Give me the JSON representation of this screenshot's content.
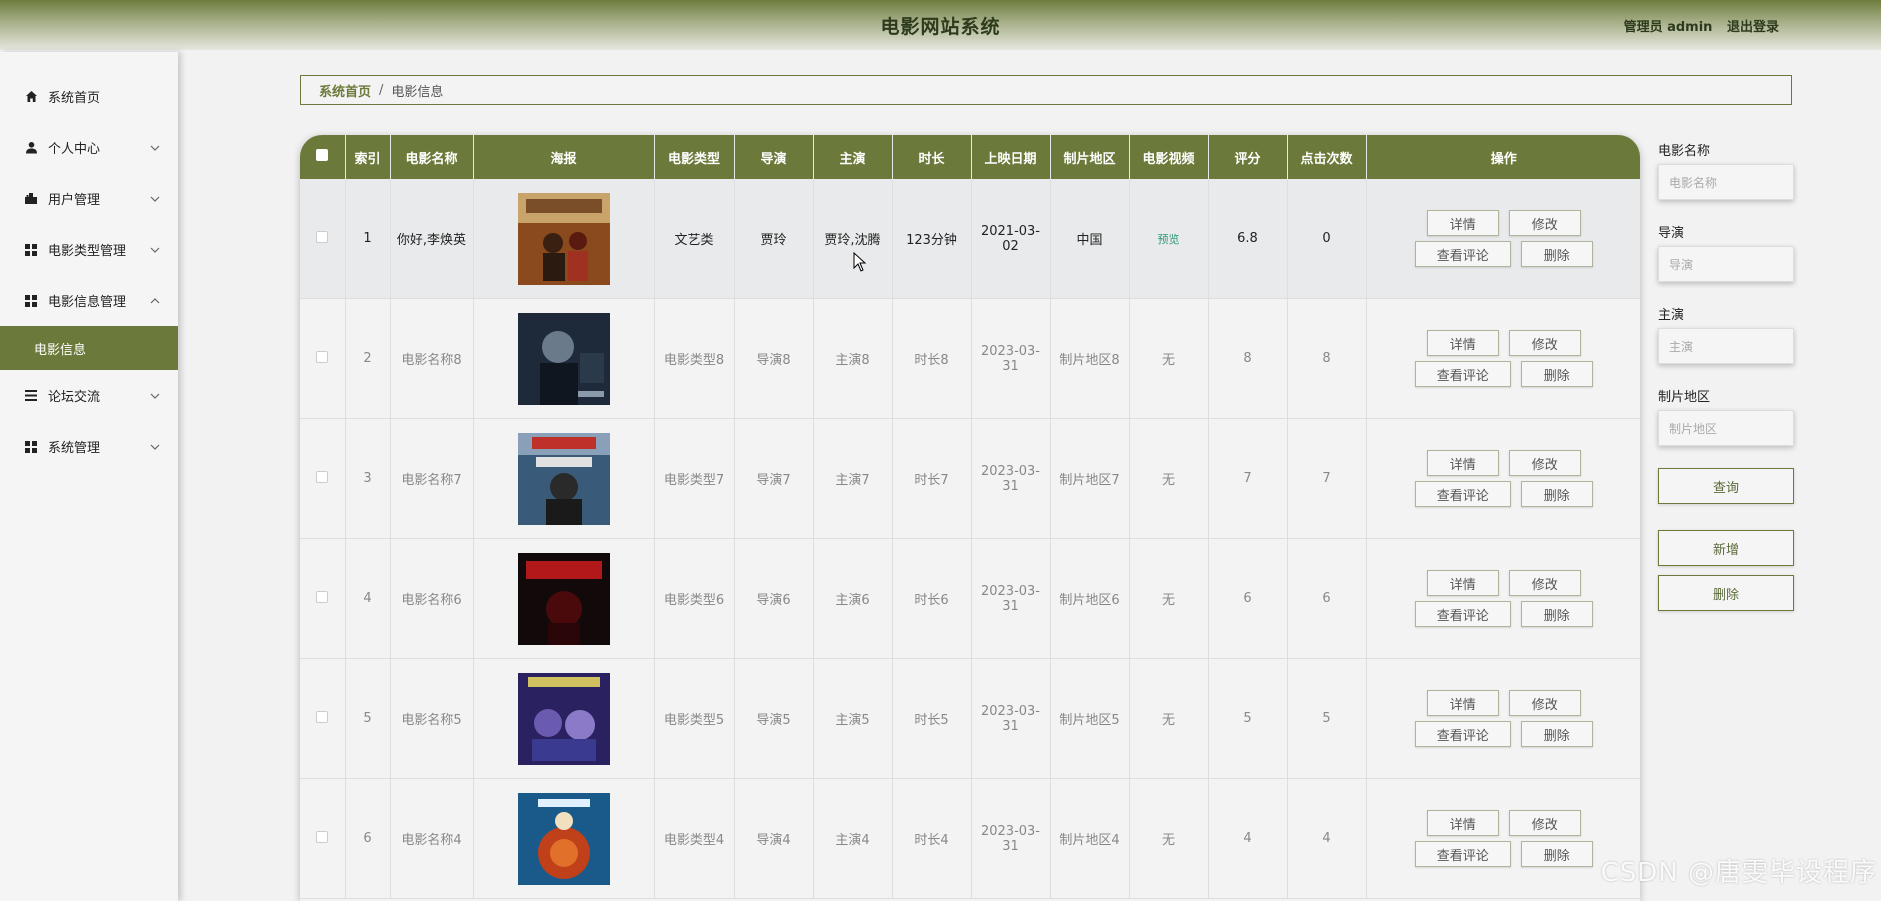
{
  "header": {
    "title": "电影网站系统",
    "user_label": "管理员 admin",
    "logout_label": "退出登录"
  },
  "sidebar": {
    "items": [
      {
        "label": "系统首页",
        "icon": "home-icon",
        "expandable": false
      },
      {
        "label": "个人中心",
        "icon": "user-icon",
        "expandable": true
      },
      {
        "label": "用户管理",
        "icon": "users-icon",
        "expandable": true
      },
      {
        "label": "电影类型管理",
        "icon": "grid-icon",
        "expandable": true
      },
      {
        "label": "电影信息管理",
        "icon": "grid-icon",
        "expandable": true,
        "expanded": true
      },
      {
        "label": "论坛交流",
        "icon": "list-icon",
        "expandable": true
      },
      {
        "label": "系统管理",
        "icon": "grid-icon",
        "expandable": true
      }
    ],
    "active_sub": "电影信息"
  },
  "breadcrumb": {
    "home": "系统首页",
    "separator": "/",
    "current": "电影信息"
  },
  "table": {
    "columns": [
      "索引",
      "电影名称",
      "海报",
      "电影类型",
      "导演",
      "主演",
      "时长",
      "上映日期",
      "制片地区",
      "电影视频",
      "评分",
      "点击次数",
      "操作"
    ],
    "rows": [
      {
        "index": "1",
        "name": "你好,李焕英",
        "type": "文艺类",
        "director": "贾玲",
        "actors": "贾玲,沈腾",
        "duration": "123分钟",
        "date": "2021-03-02",
        "region": "中国",
        "video": "预览",
        "rating": "6.8",
        "clicks": "0"
      },
      {
        "index": "2",
        "name": "电影名称8",
        "type": "电影类型8",
        "director": "导演8",
        "actors": "主演8",
        "duration": "时长8",
        "date": "2023-03-31",
        "region": "制片地区8",
        "video": "无",
        "rating": "8",
        "clicks": "8"
      },
      {
        "index": "3",
        "name": "电影名称7",
        "type": "电影类型7",
        "director": "导演7",
        "actors": "主演7",
        "duration": "时长7",
        "date": "2023-03-31",
        "region": "制片地区7",
        "video": "无",
        "rating": "7",
        "clicks": "7"
      },
      {
        "index": "4",
        "name": "电影名称6",
        "type": "电影类型6",
        "director": "导演6",
        "actors": "主演6",
        "duration": "时长6",
        "date": "2023-03-31",
        "region": "制片地区6",
        "video": "无",
        "rating": "6",
        "clicks": "6"
      },
      {
        "index": "5",
        "name": "电影名称5",
        "type": "电影类型5",
        "director": "导演5",
        "actors": "主演5",
        "duration": "时长5",
        "date": "2023-03-31",
        "region": "制片地区5",
        "video": "无",
        "rating": "5",
        "clicks": "5"
      },
      {
        "index": "6",
        "name": "电影名称4",
        "type": "电影类型4",
        "director": "导演4",
        "actors": "主演4",
        "duration": "时长4",
        "date": "2023-03-31",
        "region": "制片地区4",
        "video": "无",
        "rating": "4",
        "clicks": "4"
      }
    ],
    "actions": {
      "detail": "详情",
      "edit": "修改",
      "comments": "查看评论",
      "delete": "删除"
    }
  },
  "search": {
    "fields": [
      {
        "label": "电影名称",
        "placeholder": "电影名称"
      },
      {
        "label": "导演",
        "placeholder": "导演"
      },
      {
        "label": "主演",
        "placeholder": "主演"
      },
      {
        "label": "制片地区",
        "placeholder": "制片地区"
      }
    ],
    "query_label": "查询",
    "add_label": "新增",
    "delete_label": "删除"
  },
  "watermark": "CSDN @唐雯毕设程序",
  "colors": {
    "primary": "#6b7a3a",
    "header_dark": "#2d3b1c",
    "video_link": "#2a9a78"
  }
}
